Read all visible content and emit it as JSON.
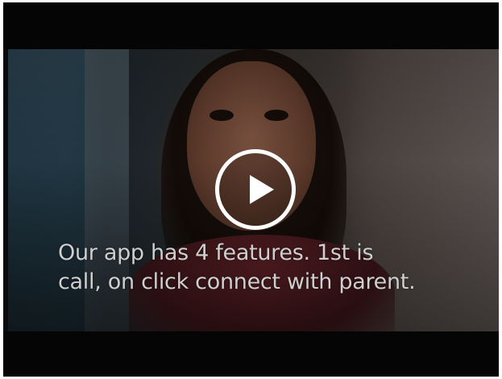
{
  "video_player": {
    "caption": {
      "line1": "Our app has 4 features. 1st is",
      "line2": "call, on click connect with parent."
    },
    "play_button_icon": "play-icon",
    "colors": {
      "letterbox": "#050505",
      "caption_text": "#cfcfcf",
      "play_button": "#ffffff"
    }
  }
}
